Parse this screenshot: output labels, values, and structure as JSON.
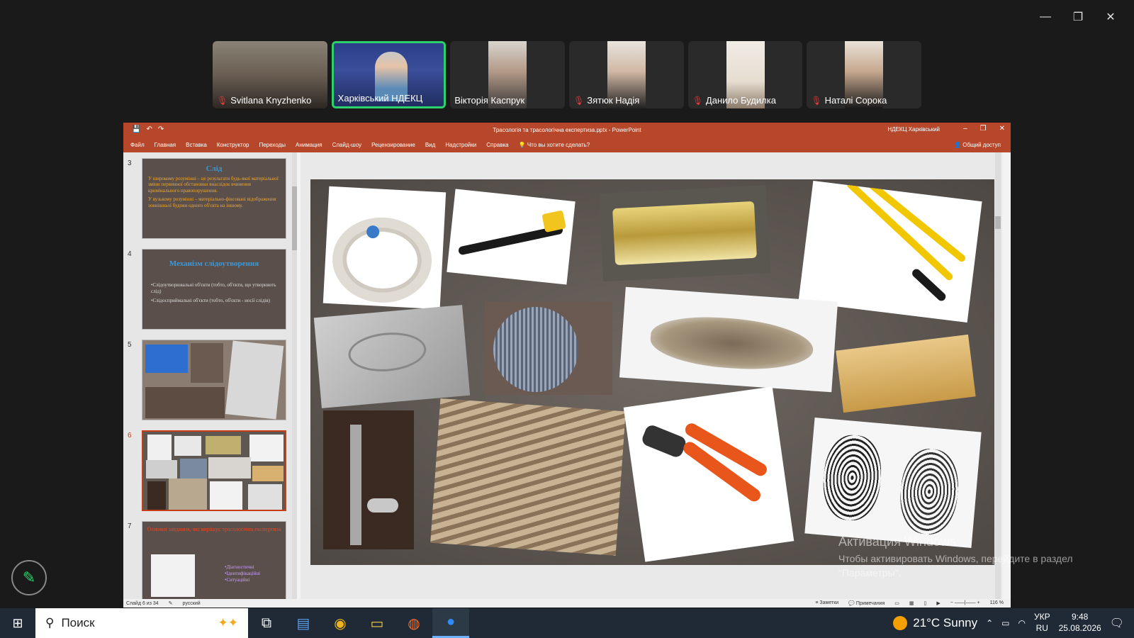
{
  "window": {
    "minimize": "—",
    "restore": "❐",
    "close": "✕"
  },
  "participants": [
    {
      "name": "Svitlana Knyzhenko",
      "muted": true
    },
    {
      "name": "Харківський НДЕКЦ",
      "muted": false
    },
    {
      "name": "Вікторія Каспрук",
      "muted": false
    },
    {
      "name": "Зятюк Надія",
      "muted": true
    },
    {
      "name": "Данило Будилка",
      "muted": true
    },
    {
      "name": "Наталі Сорока",
      "muted": true
    }
  ],
  "ppt": {
    "title": "Трасологія та трасологічна експертиза.pptx - PowerPoint",
    "account": "НДЕКЦ Харківський",
    "ribbon_tabs": [
      "Файл",
      "Главная",
      "Вставка",
      "Конструктор",
      "Переходы",
      "Анимация",
      "Слайд-шоу",
      "Рецензирование",
      "Вид",
      "Надстройки",
      "Справка"
    ],
    "tell_me": "Что вы хотите сделать?",
    "share": "Общий доступ",
    "thumbs": {
      "s3": {
        "num": "3",
        "title": "Слід",
        "body1": "У широкому розумінні – це результати будь-якої матеріальної зміни первинної обстановки внаслідок вчинення кримінального правопорушення.",
        "body2": "У вузькому розумінні – матеріально-фіксовані відображення зовнішньої будови одного об'єкта на іншому."
      },
      "s4": {
        "num": "4",
        "title": "Механізм слідоутворення",
        "body1": "•Слідоутворювальні об'єкти (тобто, об'єкти, що утворюють слід)",
        "body2": "•Слідосприймальні об'єкти (тобто, об'єкти - носії слідів)"
      },
      "s5": {
        "num": "5"
      },
      "s6": {
        "num": "6"
      },
      "s7": {
        "num": "7",
        "title": "Основні завдання, які вирішує трасологічна експертиза",
        "items": "•Діагностичні •Ідентифікаційні •Ситуаційні"
      }
    },
    "status": {
      "slide": "Слайд 6 из 34",
      "lang": "русский",
      "notes": "Заметки",
      "comments": "Примечания",
      "zoom": "116 %"
    }
  },
  "activation": {
    "line1": "Активация Windows",
    "line2": "Чтобы активировать Windows, перейдите в раздел",
    "line3": "\"Параметры\"."
  },
  "taskbar": {
    "search": "Поиск",
    "weather": "21°C  Sunny",
    "lang1": "УКР",
    "lang2": "RU",
    "time": "9:48",
    "date": "25.08.2026"
  }
}
